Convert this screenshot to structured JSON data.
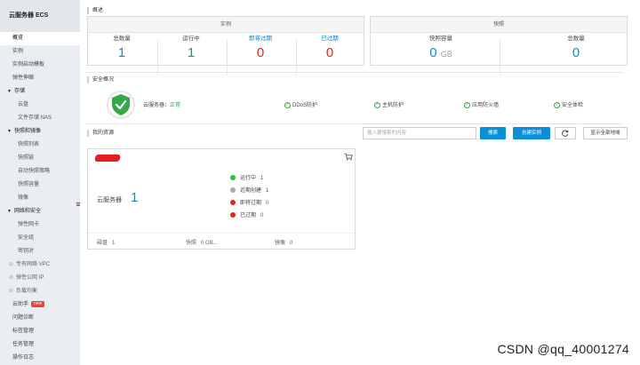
{
  "sidebar": {
    "title": "云服务器 ECS",
    "items": [
      {
        "label": "概览",
        "type": "item",
        "active": true
      },
      {
        "label": "实例",
        "type": "item"
      },
      {
        "label": "实例启动模板",
        "type": "item"
      },
      {
        "label": "弹性伸缩",
        "type": "item"
      },
      {
        "label": "存储",
        "type": "group"
      },
      {
        "label": "云盘",
        "type": "sub"
      },
      {
        "label": "文件存储 NAS",
        "type": "sub"
      },
      {
        "label": "快照和镜像",
        "type": "group"
      },
      {
        "label": "快照列表",
        "type": "sub"
      },
      {
        "label": "快照链",
        "type": "sub"
      },
      {
        "label": "自动快照策略",
        "type": "sub"
      },
      {
        "label": "快照容量",
        "type": "sub"
      },
      {
        "label": "镜像",
        "type": "sub"
      },
      {
        "label": "网络和安全",
        "type": "group"
      },
      {
        "label": "弹性网卡",
        "type": "sub"
      },
      {
        "label": "安全组",
        "type": "sub"
      },
      {
        "label": "密钥对",
        "type": "sub"
      },
      {
        "label": "专有网络 VPC",
        "type": "link"
      },
      {
        "label": "弹性公网 IP",
        "type": "link"
      },
      {
        "label": "负载均衡",
        "type": "link"
      },
      {
        "label": "云助手",
        "type": "item",
        "badge": "new"
      },
      {
        "label": "问题诊断",
        "type": "item"
      },
      {
        "label": "标签管理",
        "type": "item"
      },
      {
        "label": "任务管理",
        "type": "item"
      },
      {
        "label": "操作日志",
        "type": "item"
      }
    ]
  },
  "overview": {
    "section_title": "概述",
    "instances": {
      "header": "实例",
      "stats": [
        {
          "label": "总数量",
          "value": "1",
          "color": "blue"
        },
        {
          "label": "运行中",
          "value": "1",
          "color": "green"
        },
        {
          "label": "即将过期",
          "value": "0",
          "color": "red"
        },
        {
          "label": "已过期",
          "value": "0",
          "color": "red"
        }
      ]
    },
    "snapshots": {
      "header": "快照",
      "stats": [
        {
          "label": "快照容量",
          "value": "0",
          "unit": "GB"
        },
        {
          "label": "总数量",
          "value": "0"
        }
      ]
    }
  },
  "security": {
    "section_title": "安全概况",
    "server_label": "云服务器：",
    "server_status": "正常",
    "checks": [
      "DDoS防护",
      "主机防护",
      "应用防火墙",
      "安全体检"
    ]
  },
  "resources": {
    "section_title": "我的资源",
    "search_placeholder": "输入要搜索的内容",
    "search_button": "搜索",
    "create_button": "创建实例",
    "show_all_button": "显示全部地域",
    "card": {
      "server_label": "云服务器",
      "server_count": "1",
      "statuses": [
        {
          "label": "运行中",
          "count": "1",
          "color": "#2dbd3c"
        },
        {
          "label": "近期创建",
          "count": "1",
          "color": "#aaaaaa"
        },
        {
          "label": "即将过期",
          "count": "0",
          "color": "#e0281f"
        },
        {
          "label": "已过期",
          "count": "0",
          "color": "#e0281f"
        }
      ],
      "footer": [
        {
          "label": "磁盘",
          "value": "1"
        },
        {
          "label": "快照",
          "value": "0 GB..."
        },
        {
          "label": "镜像",
          "value": "0"
        }
      ]
    }
  },
  "watermark": "CSDN @qq_40001274",
  "colors": {
    "primary": "#0b8fd6",
    "green": "#1aa142",
    "red": "#e0281f",
    "blue": "#1889c7"
  }
}
